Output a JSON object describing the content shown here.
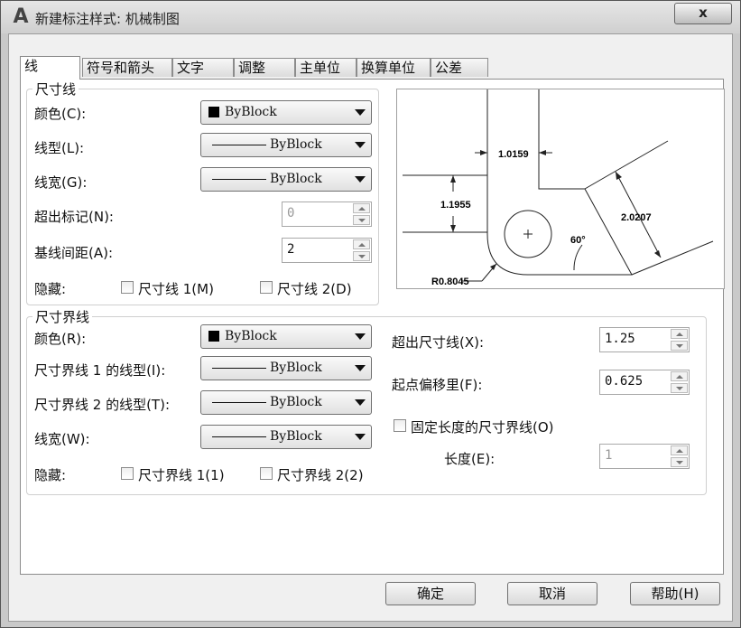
{
  "window": {
    "title": "新建标注样式: 机械制图",
    "close_label": "x"
  },
  "tabs": [
    "线",
    "符号和箭头",
    "文字",
    "调整",
    "主单位",
    "换算单位",
    "公差"
  ],
  "dim_lines": {
    "legend": "尺寸线",
    "color_label": "颜色(C):",
    "color_value": "ByBlock",
    "linetype_label": "线型(L):",
    "linetype_value": "ByBlock",
    "lineweight_label": "线宽(G):",
    "lineweight_value": "ByBlock",
    "extend_ticks_label": "超出标记(N):",
    "extend_ticks_value": "0",
    "baseline_spacing_label": "基线间距(A):",
    "baseline_spacing_value": "2",
    "suppress_label": "隐藏:",
    "suppress_1": "尺寸线 1(M)",
    "suppress_2": "尺寸线 2(D)"
  },
  "ext_lines": {
    "legend": "尺寸界线",
    "color_label": "颜色(R):",
    "color_value": "ByBlock",
    "linetype1_label": "尺寸界线 1 的线型(I):",
    "linetype1_value": "ByBlock",
    "linetype2_label": "尺寸界线 2 的线型(T):",
    "linetype2_value": "ByBlock",
    "lineweight_label": "线宽(W):",
    "lineweight_value": "ByBlock",
    "suppress_label": "隐藏:",
    "suppress_1": "尺寸界线 1(1)",
    "suppress_2": "尺寸界线 2(2)",
    "extend_label": "超出尺寸线(X):",
    "extend_value": "1.25",
    "offset_label": "起点偏移里(F):",
    "offset_value": "0.625",
    "fixed_length_label": "固定长度的尺寸界线(O)",
    "length_label": "长度(E):",
    "length_value": "1"
  },
  "preview": {
    "dim_top": "1.0159",
    "dim_left": "1.1955",
    "dim_right": "2.0207",
    "angle": "60°",
    "radius": "R0.8045"
  },
  "buttons": {
    "ok": "确定",
    "cancel": "取消",
    "help": "帮助(H)"
  }
}
